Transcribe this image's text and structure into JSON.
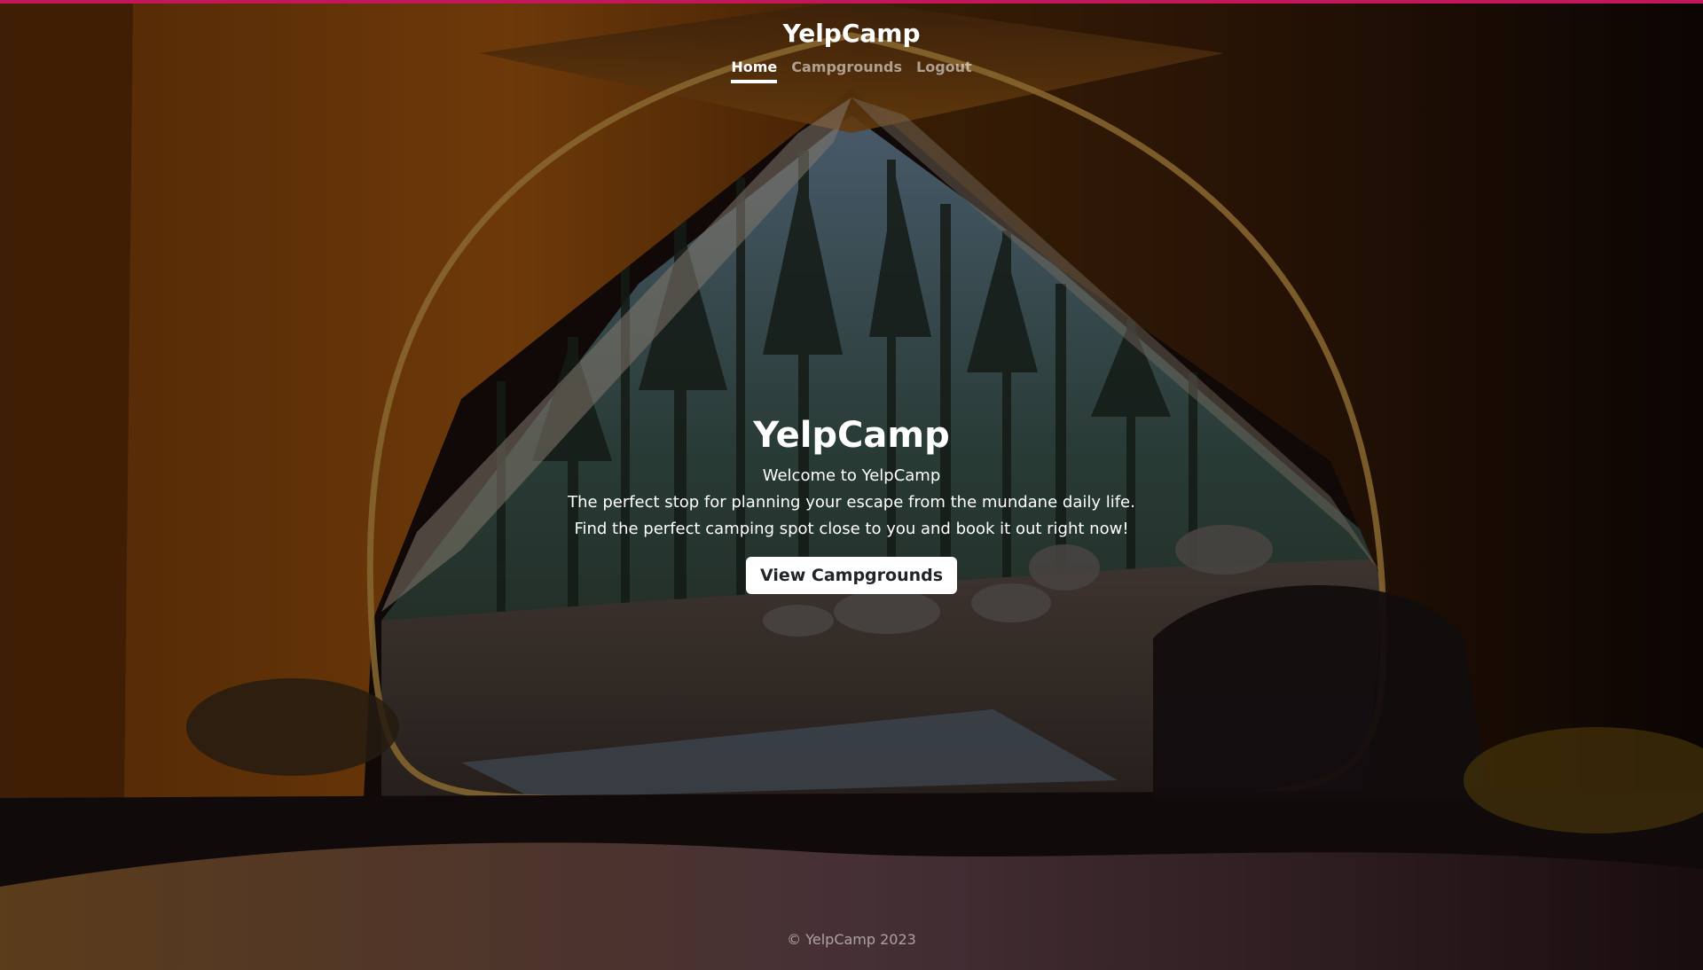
{
  "header": {
    "brand": "YelpCamp",
    "nav": [
      {
        "label": "Home"
      },
      {
        "label": "Campgrounds"
      },
      {
        "label": "Logout"
      }
    ]
  },
  "hero": {
    "title": "YelpCamp",
    "lines": [
      "Welcome to YelpCamp",
      "The perfect stop for planning your escape from the mundane daily life.",
      "Find the perfect camping spot close to you and book it out right now!"
    ],
    "cta_label": "View Campgrounds"
  },
  "footer": {
    "text": "© YelpCamp 2023"
  },
  "colors": {
    "accent_bar": "#c2185b",
    "tent_orange": "#b8650e",
    "button_bg": "#ffffff"
  }
}
